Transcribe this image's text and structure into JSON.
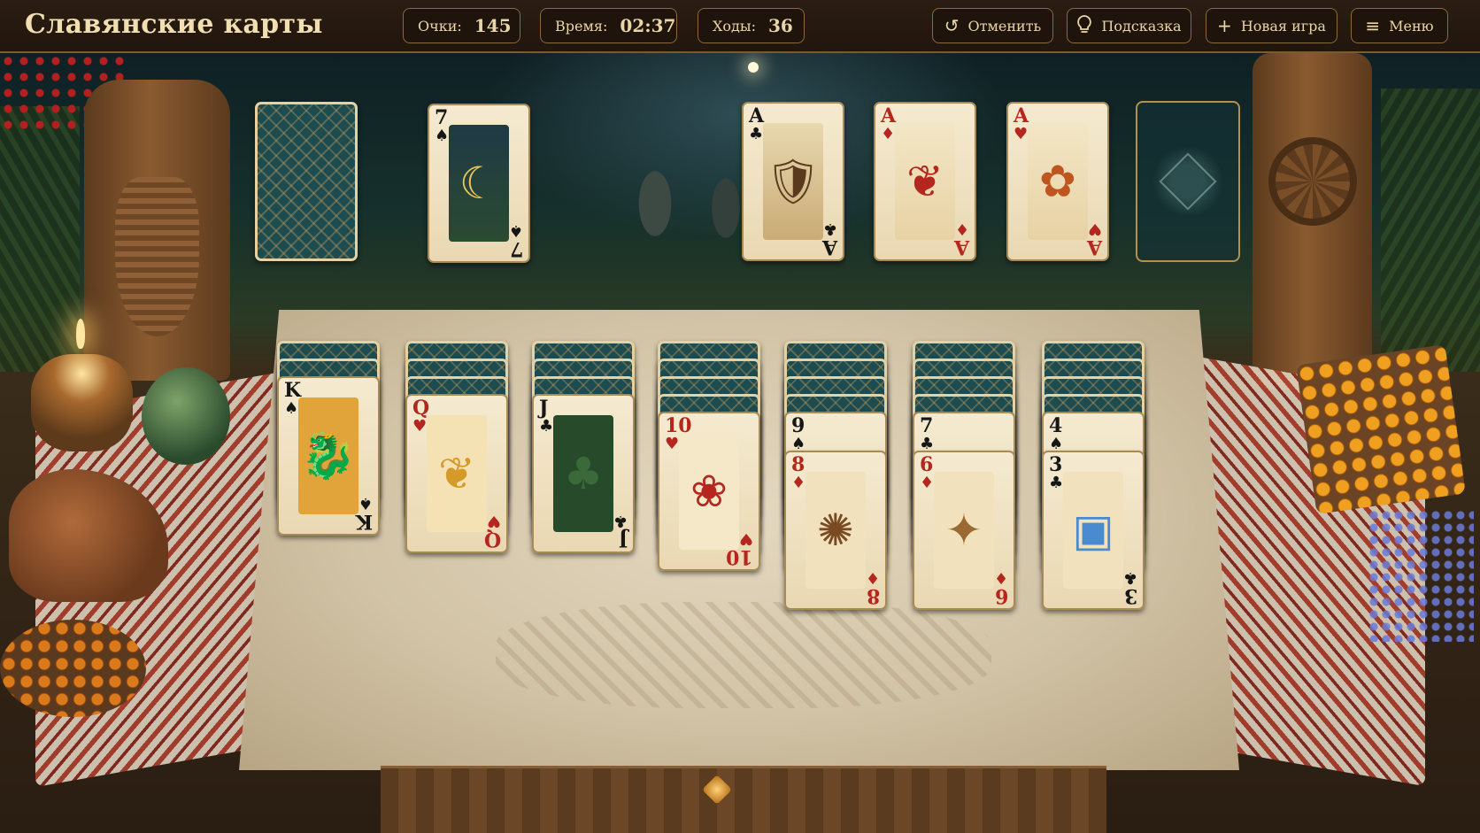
{
  "header": {
    "title": "Славянские карты",
    "score_label": "Очки:",
    "score_value": "145",
    "time_label": "Время:",
    "time_value": "02:37",
    "moves_label": "Ходы:",
    "moves_value": "36",
    "undo_label": "Отменить",
    "hint_label": "Подсказка",
    "new_game_label": "Новая игра",
    "menu_label": "Меню",
    "icons": {
      "undo": "undo-arrow-icon",
      "hint": "lightbulb-icon",
      "new_game": "plus-icon",
      "menu": "hamburger-icon"
    }
  },
  "colors": {
    "topbar": "#21160d",
    "accent_border": "#8a6a3a",
    "text": "#ead5a6",
    "card_back": "#1d4c50",
    "card_face": "#f5ead0",
    "red_suit": "#b5261e",
    "black_suit": "#161616"
  },
  "stock": {
    "face_down": true
  },
  "waste": {
    "rank": "7",
    "suit": "♠",
    "art": "owl-moon"
  },
  "foundations": [
    {
      "rank": "A",
      "suit": "♣",
      "art": "bear-warrior"
    },
    {
      "rank": "A",
      "suit": "♦",
      "art": "firebird"
    },
    {
      "rank": "A",
      "suit": "♥",
      "art": "fox-lantern"
    },
    {
      "empty": true
    }
  ],
  "tableau": [
    {
      "hidden": 2,
      "visible": [
        {
          "rank": "K",
          "suit": "♠",
          "art": "three-headed-dragon"
        }
      ]
    },
    {
      "hidden": 3,
      "visible": [
        {
          "rank": "Q",
          "suit": "♥",
          "art": "golden-bird"
        }
      ]
    },
    {
      "hidden": 3,
      "visible": [
        {
          "rank": "J",
          "suit": "♣",
          "art": "leshy-forest-spirit"
        }
      ]
    },
    {
      "hidden": 4,
      "visible": [
        {
          "rank": "10",
          "suit": "♥",
          "art": "poppy-wreath"
        }
      ]
    },
    {
      "hidden": 4,
      "visible": [
        {
          "rank": "9",
          "suit": "♠"
        },
        {
          "rank": "8",
          "suit": "♦",
          "art": "hedgehog"
        }
      ]
    },
    {
      "hidden": 4,
      "visible": [
        {
          "rank": "7",
          "suit": "♣"
        },
        {
          "rank": "6",
          "suit": "♦",
          "art": "deer"
        }
      ]
    },
    {
      "hidden": 4,
      "visible": [
        {
          "rank": "4",
          "suit": "♠"
        },
        {
          "rank": "3",
          "suit": "♣",
          "art": "treasure-chest"
        }
      ]
    }
  ]
}
